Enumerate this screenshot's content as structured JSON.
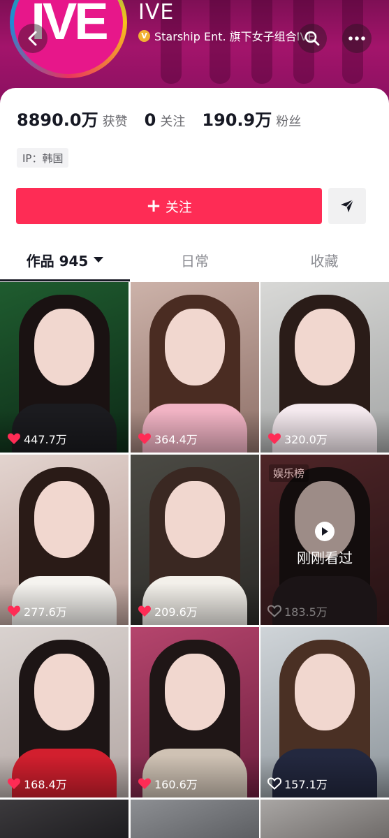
{
  "header": {
    "logo_text": "IVE",
    "name": "IVE",
    "verify_badge": "V",
    "verification": "Starship Ent. 旗下女子组合IVE"
  },
  "stats": [
    {
      "value": "8890.0万",
      "label": "获赞"
    },
    {
      "value": "0",
      "label": "关注"
    },
    {
      "value": "190.9万",
      "label": "粉丝"
    }
  ],
  "ip_tag": "IP：韩国",
  "follow_button": {
    "icon": "+",
    "label": "关注"
  },
  "tabs": [
    {
      "label": "作品 945",
      "active": true
    },
    {
      "label": "日常",
      "active": false
    },
    {
      "label": "收藏",
      "active": false
    }
  ],
  "videos": [
    {
      "likes": "447.7万",
      "liked": true
    },
    {
      "likes": "364.4万",
      "liked": true
    },
    {
      "likes": "320.0万",
      "liked": true
    },
    {
      "likes": "277.6万",
      "liked": true
    },
    {
      "likes": "209.6万",
      "liked": true
    },
    {
      "likes": "183.5万",
      "liked": false,
      "badge": "娱乐榜",
      "recent_label": "刚刚看过"
    },
    {
      "likes": "168.4万",
      "liked": true
    },
    {
      "likes": "160.6万",
      "liked": true
    },
    {
      "likes": "157.1万",
      "liked": false
    }
  ],
  "colors": {
    "accent": "#fe2c55",
    "banner": "#a3146b",
    "text": "#161823"
  }
}
